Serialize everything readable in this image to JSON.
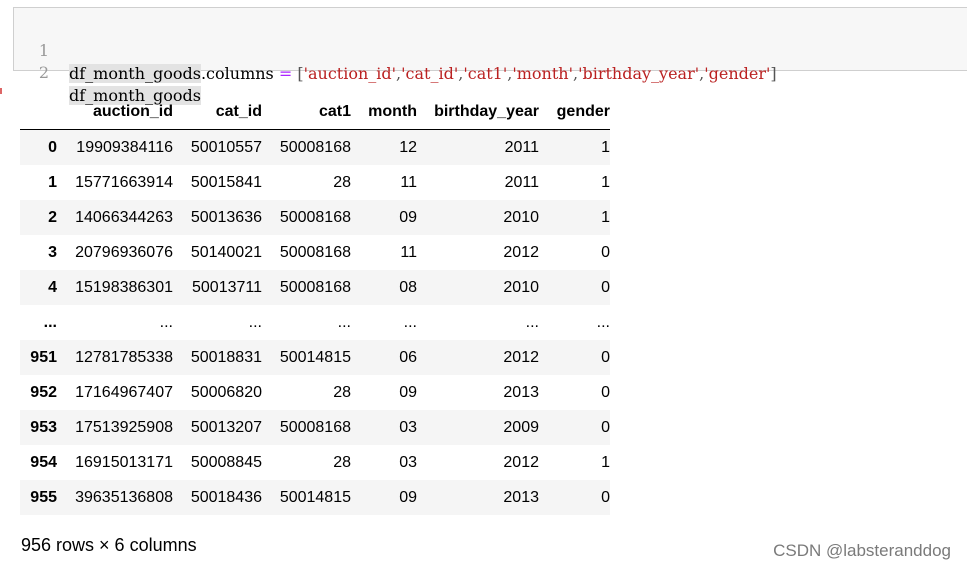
{
  "code_cell": {
    "line_numbers": [
      "1",
      "2"
    ],
    "line1": {
      "var": "df_month_goods",
      "dot_attr": ".columns",
      "op": " = ",
      "open": "[",
      "s1": "'auction_id'",
      "s2": "'cat_id'",
      "s3": "'cat1'",
      "s4": "'month'",
      "s5": "'birthday_year'",
      "s6": "'gender'",
      "comma": ",",
      "close": "]"
    },
    "line2": "df_month_goods"
  },
  "dataframe": {
    "columns": [
      "",
      "auction_id",
      "cat_id",
      "cat1",
      "month",
      "birthday_year",
      "gender"
    ],
    "rows": [
      [
        "0",
        "19909384116",
        "50010557",
        "50008168",
        "12",
        "2011",
        "1"
      ],
      [
        "1",
        "15771663914",
        "50015841",
        "28",
        "11",
        "2011",
        "1"
      ],
      [
        "2",
        "14066344263",
        "50013636",
        "50008168",
        "09",
        "2010",
        "1"
      ],
      [
        "3",
        "20796936076",
        "50140021",
        "50008168",
        "11",
        "2012",
        "0"
      ],
      [
        "4",
        "15198386301",
        "50013711",
        "50008168",
        "08",
        "2010",
        "0"
      ],
      [
        "...",
        "...",
        "...",
        "...",
        "...",
        "...",
        "..."
      ],
      [
        "951",
        "12781785338",
        "50018831",
        "50014815",
        "06",
        "2012",
        "0"
      ],
      [
        "952",
        "17164967407",
        "50006820",
        "28",
        "09",
        "2013",
        "0"
      ],
      [
        "953",
        "17513925908",
        "50013207",
        "50008168",
        "03",
        "2009",
        "0"
      ],
      [
        "954",
        "16915013171",
        "50008845",
        "28",
        "03",
        "2012",
        "1"
      ],
      [
        "955",
        "39635136808",
        "50018436",
        "50014815",
        "09",
        "2013",
        "0"
      ]
    ],
    "shape_text": "956 rows × 6 columns"
  },
  "watermark": "CSDN @labsteranddog"
}
